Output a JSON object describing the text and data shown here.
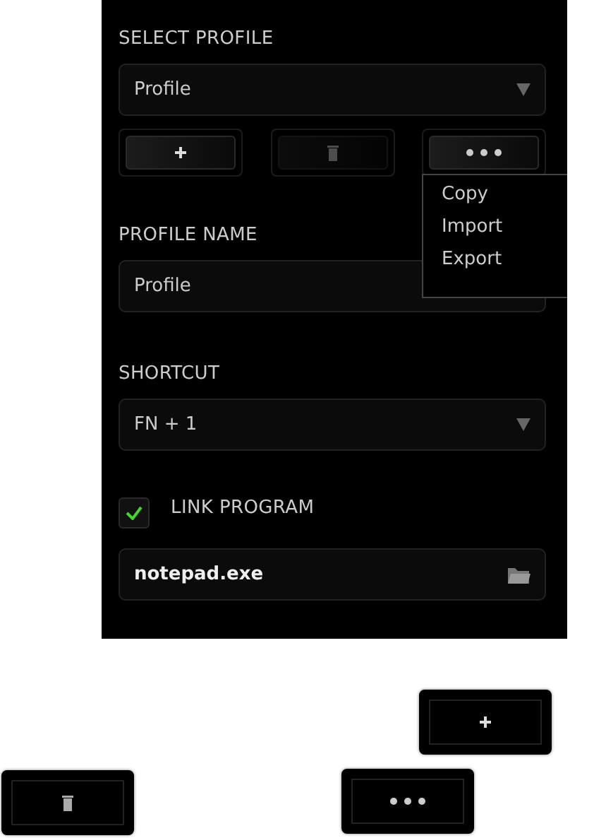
{
  "panel": {
    "select_profile": {
      "label": "SELECT PROFILE",
      "value": "Profile"
    },
    "profile_buttons": [
      {
        "kind": "add",
        "disabled": false
      },
      {
        "kind": "delete",
        "disabled": true
      },
      {
        "kind": "more",
        "disabled": false
      }
    ],
    "more_menu": {
      "items": [
        "Copy",
        "Import",
        "Export"
      ]
    },
    "profile_name": {
      "label": "PROFILE NAME",
      "value": "Profile"
    },
    "shortcut": {
      "label": "SHORTCUT",
      "value": "FN + 1"
    },
    "link_program": {
      "label": "LINK PROGRAM",
      "checked": true
    },
    "program_path": {
      "value": "notepad.exe"
    }
  },
  "button_legend": [
    {
      "kind": "add"
    },
    {
      "kind": "delete"
    },
    {
      "kind": "more"
    }
  ]
}
